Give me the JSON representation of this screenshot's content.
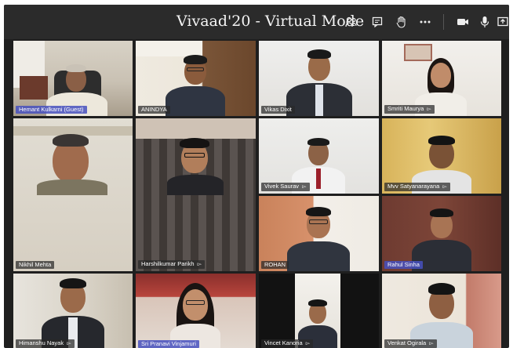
{
  "window": {
    "title": "Vivaad'20 - Virtual Mode"
  },
  "toolbar": {
    "icons": [
      {
        "name": "participants-icon",
        "glyph": "⚇"
      },
      {
        "name": "chat-icon",
        "glyph": "☰"
      },
      {
        "name": "raise-hand-icon",
        "glyph": "✋"
      },
      {
        "name": "more-options-icon",
        "glyph": "•••"
      },
      {
        "name": "camera-icon",
        "glyph": "■"
      },
      {
        "name": "microphone-icon",
        "glyph": "●"
      },
      {
        "name": "share-screen-icon",
        "glyph": "⇪"
      }
    ]
  },
  "participants": [
    {
      "name": "Hemant Kulkarni (Guest)",
      "mic": false,
      "active": true
    },
    {
      "name": "ANINDYA",
      "mic": false,
      "active": false
    },
    {
      "name": "Vikas Dixit",
      "mic": false,
      "active": false
    },
    {
      "name": "Smriti Maurya",
      "mic": true,
      "active": false
    },
    {
      "name": "Nikhil Mehta",
      "mic": false,
      "active": false
    },
    {
      "name": "Harshilkumar Parikh",
      "mic": true,
      "active": false
    },
    {
      "name": "Vivek Saurav",
      "mic": true,
      "active": false
    },
    {
      "name": "Mvv Satyanarayana",
      "mic": true,
      "active": false
    },
    {
      "name": "ROHAN",
      "mic": false,
      "active": false
    },
    {
      "name": "Rahul Sinha",
      "mic": false,
      "active": true
    },
    {
      "name": "Himanshu Nayak",
      "mic": true,
      "active": false
    },
    {
      "name": "Sri Pranavi Vinjamuri",
      "mic": false,
      "active": true
    },
    {
      "name": "Vincet Kanoria",
      "mic": true,
      "active": false
    },
    {
      "name": "Venkat Ogirala",
      "mic": true,
      "active": false
    }
  ],
  "colors": {
    "titlebar": "#2b2b2b",
    "active_nameplate": "#4650be"
  }
}
